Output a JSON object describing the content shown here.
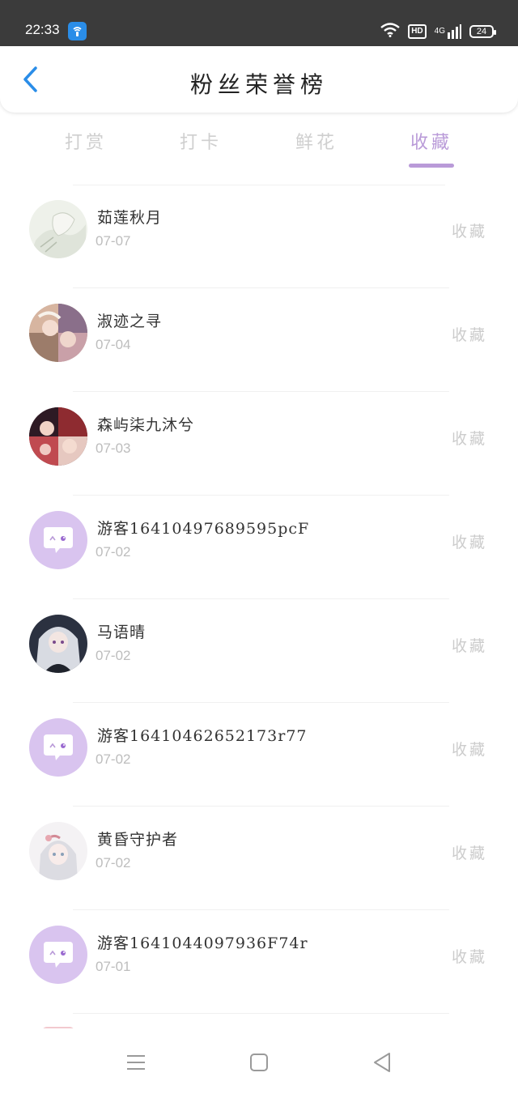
{
  "status_bar": {
    "time": "22:33",
    "hd": "HD",
    "network": "4G",
    "battery": "24"
  },
  "header": {
    "title": "粉丝荣誉榜",
    "back_icon": "chevron-left-icon"
  },
  "tabs": [
    {
      "label": "打赏",
      "active": false
    },
    {
      "label": "打卡",
      "active": false
    },
    {
      "label": "鲜花",
      "active": false
    },
    {
      "label": "收藏",
      "active": true
    }
  ],
  "colors": {
    "accent": "#b99ad8",
    "back_icon": "#2a8de8",
    "muted_text": "#cfcfcf",
    "status_bar_bg": "#3b3b3b"
  },
  "fans": [
    {
      "name": "茹莲秋月",
      "date": "07-07",
      "action": "收藏",
      "avatar": "anime-avatar"
    },
    {
      "name": "淑迹之寻",
      "date": "07-04",
      "action": "收藏",
      "avatar": "anime-avatar"
    },
    {
      "name": "森屿柒九沐兮",
      "date": "07-03",
      "action": "收藏",
      "avatar": "anime-avatar"
    },
    {
      "name": "游客16410497689595pcF",
      "date": "07-02",
      "action": "收藏",
      "avatar": "default-chat-avatar"
    },
    {
      "name": "马语晴",
      "date": "07-02",
      "action": "收藏",
      "avatar": "anime-avatar"
    },
    {
      "name": "游客16410462652173r77",
      "date": "07-02",
      "action": "收藏",
      "avatar": "default-chat-avatar"
    },
    {
      "name": "黄昏守护者",
      "date": "07-02",
      "action": "收藏",
      "avatar": "anime-avatar"
    },
    {
      "name": "游客1641044097936F74r",
      "date": "07-01",
      "action": "收藏",
      "avatar": "default-chat-avatar"
    }
  ],
  "nav_bar": {
    "menu_icon": "menu-icon",
    "home_icon": "home-square-icon",
    "back_icon": "back-triangle-icon"
  }
}
